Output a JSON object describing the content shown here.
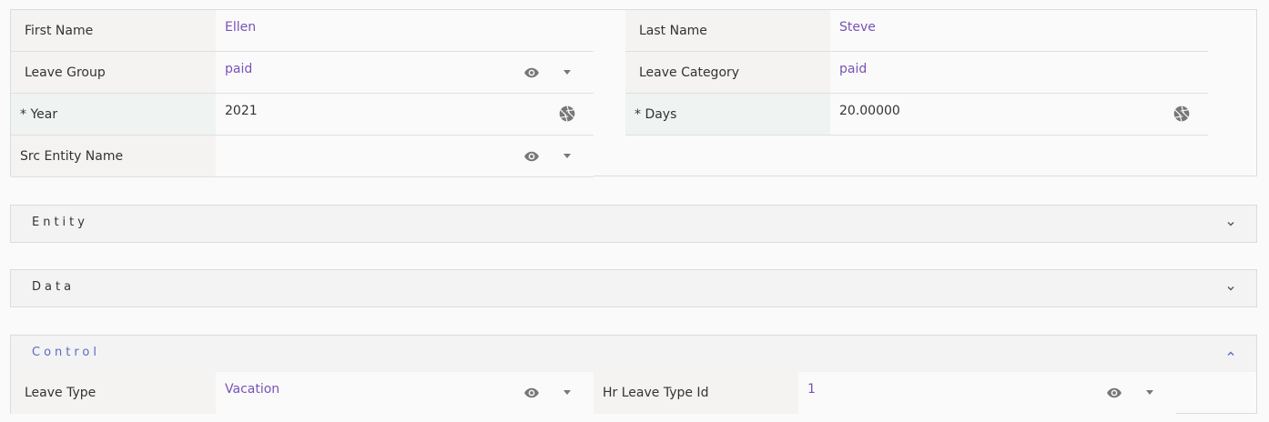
{
  "fields": {
    "first_name": {
      "label": "First Name",
      "value": "Ellen"
    },
    "last_name": {
      "label": "Last Name",
      "value": "Steve"
    },
    "leave_group": {
      "label": "Leave Group",
      "value": "paid"
    },
    "leave_category": {
      "label": "Leave Category",
      "value": "paid"
    },
    "year": {
      "label": "* Year",
      "value": "2021"
    },
    "days": {
      "label": "* Days",
      "value": "20.00000"
    },
    "src_entity_name": {
      "label": "Src Entity Name",
      "value": ""
    }
  },
  "sections": {
    "entity": {
      "title": "Entity",
      "expanded": false
    },
    "data": {
      "title": "Data",
      "expanded": false
    },
    "control": {
      "title": "Control",
      "expanded": true
    }
  },
  "control": {
    "leave_type": {
      "label": "Leave Type",
      "value": "Vacation"
    },
    "hr_leave_type_id": {
      "label": "Hr Leave Type Id",
      "value": "1"
    }
  },
  "colors": {
    "link_value": "#7a52b8",
    "section_active": "#5c6bc0",
    "label_bg": "#f4f3f1"
  }
}
